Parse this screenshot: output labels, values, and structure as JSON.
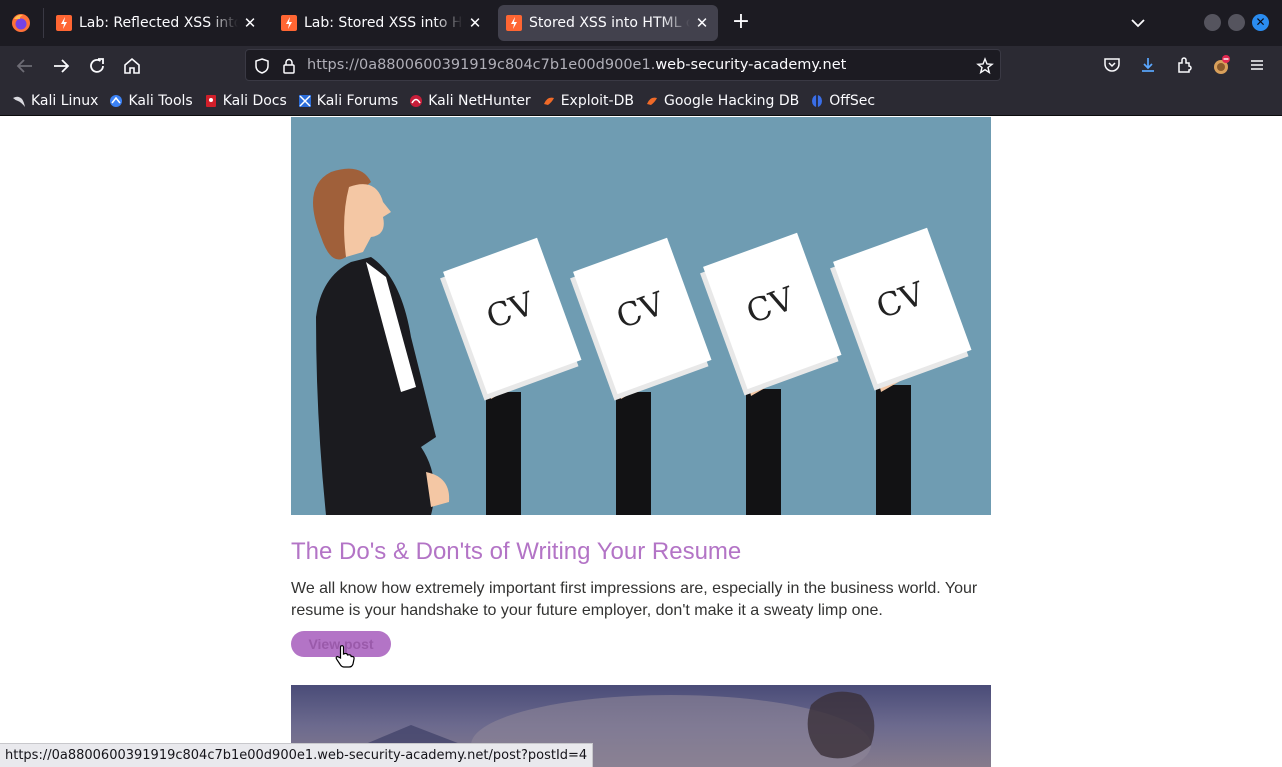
{
  "browser": {
    "tabs": [
      {
        "title": "Lab: Reflected XSS into HTML context with nothing encoded",
        "active": false
      },
      {
        "title": "Lab: Stored XSS into HTML context with nothing encoded",
        "active": false
      },
      {
        "title": "Stored XSS into HTML context with nothing encoded",
        "active": true
      }
    ],
    "url_prefix": "https://0a8800600391919c804c7b1e00d900e1.",
    "url_domain": "web-security-academy.net",
    "bookmarks": [
      {
        "label": "Kali Linux",
        "icon": "kali-dragon-icon"
      },
      {
        "label": "Kali Tools",
        "icon": "kali-tools-icon"
      },
      {
        "label": "Kali Docs",
        "icon": "kali-docs-icon"
      },
      {
        "label": "Kali Forums",
        "icon": "kali-forums-icon"
      },
      {
        "label": "Kali NetHunter",
        "icon": "nethunter-icon"
      },
      {
        "label": "Exploit-DB",
        "icon": "exploit-db-icon"
      },
      {
        "label": "Google Hacking DB",
        "icon": "ghdb-icon"
      },
      {
        "label": "OffSec",
        "icon": "offsec-icon"
      }
    ],
    "status_url": "https://0a8800600391919c804c7b1e00d900e1.web-security-academy.net/post?postId=4"
  },
  "colors": {
    "accent": "#b374c6",
    "tab_bg": "#1c1b22",
    "toolbar_bg": "#2b2a33",
    "hero_bg": "#6f9cb2"
  },
  "post": {
    "image_text": "CV",
    "title": "The Do's & Don'ts of Writing Your Resume",
    "summary": "We all know how extremely important first impressions are, especially in the business world. Your resume is your handshake to your future employer, don't make it a sweaty limp one.",
    "button_label": "View post"
  }
}
